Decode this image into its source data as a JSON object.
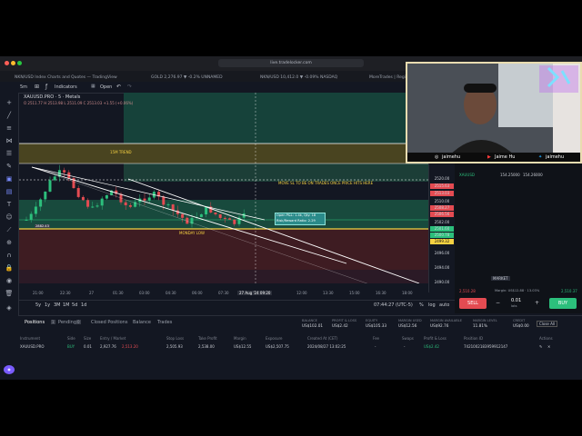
{
  "browser": {
    "address": "live.tradelocker.com",
    "tabs": [
      "NKN/USD Index Charts and Quotes — TradingView",
      "GOLD 2,276.97 ▼ -0.2% UNNAMED",
      "NKN/USD 10,412.0 ▼ -0.09% NASDAQ",
      "MoreTrades | Registrati..."
    ]
  },
  "toolbar": {
    "interval": "5m",
    "indicators_label": "Indicators",
    "open_label": "Open"
  },
  "chart": {
    "symbol": "XAUUSD.PRO · 5 · Metals",
    "ohlc": "O 2511.77  H 2513.98  L 2511.09  C 2513.03  +1.55 (+0.06%)",
    "annotations": {
      "trend": "15M TREND",
      "move_sl": "MOVE SL TO BE ON TRADES ONCE PRICE HITS HERE",
      "monday_low": "MONDAY LOW",
      "box_line1": "Open P&L: 1.4k, Qty: 18",
      "box_line2": "Risk/Reward Ratio: 2.29",
      "left_label": "2882.43"
    },
    "colors": {
      "green_zone": "#1a4a3a",
      "red_zone": "#4a1f24",
      "yellow_zone": "#5c5420",
      "accent_yellow": "#f5d142"
    }
  },
  "price_axis": {
    "labels": [
      {
        "text": "2520.00",
        "style": "plain"
      },
      {
        "text": "2515.63",
        "style": "red"
      },
      {
        "text": "2513.03",
        "style": "red"
      },
      {
        "text": "2510.00",
        "style": "plain"
      },
      {
        "text": "2508.27",
        "style": "red"
      },
      {
        "text": "2506.56",
        "style": "red"
      },
      {
        "text": "2502.00",
        "style": "plain"
      },
      {
        "text": "2501.60",
        "style": "green"
      },
      {
        "text": "2500.78",
        "style": "green"
      },
      {
        "text": "2499.32",
        "style": "yellow"
      },
      {
        "text": "2496.00",
        "style": "plain"
      },
      {
        "text": "2494.00",
        "style": "plain"
      },
      {
        "text": "2490.00",
        "style": "plain"
      }
    ]
  },
  "time_axis": {
    "labels": [
      "21:00",
      "22:30",
      "27",
      "01:30",
      "03:00",
      "04:30",
      "06:00",
      "07:30",
      "27 Aug '24  09:20",
      "12:00",
      "13:30",
      "15:00",
      "16:30",
      "18:00"
    ]
  },
  "bottom": {
    "ranges": [
      "5y",
      "1y",
      "3M",
      "1M",
      "5d",
      "1d"
    ],
    "time": "07:44:27 (UTC-5)",
    "opts": [
      "%",
      "log",
      "auto"
    ]
  },
  "positions_panel": {
    "tabs": [
      "Positions",
      "Pending",
      "Closed Positions",
      "Balance",
      "Trades"
    ],
    "positions_count": "1",
    "pending_count": "0",
    "summary": [
      {
        "label": "BALANCE",
        "value": "US$102.01"
      },
      {
        "label": "PROFIT & LOSS",
        "value": "US$2.42"
      },
      {
        "label": "EQUITY",
        "value": "US$105.33"
      },
      {
        "label": "MARGIN USED",
        "value": "US$12.56"
      },
      {
        "label": "MARGIN AVAILABLE",
        "value": "US$92.76"
      },
      {
        "label": "MARGIN LEVEL",
        "value": "11.81%"
      },
      {
        "label": "CREDIT",
        "value": "US$0.00"
      }
    ],
    "close_all": "Close All",
    "columns": [
      "Instrument",
      "Side",
      "Size",
      "Entry / Market",
      "Stop Loss",
      "Take Profit",
      "Margin",
      "Exposure",
      "Created At (CET)",
      "Fee",
      "Swaps",
      "Profit & Loss",
      "Position ID",
      "Actions"
    ],
    "row": {
      "instrument": "XAUUSD.PRO",
      "side": "BUY",
      "size": "0.01",
      "entry": "2,927.76",
      "market": "2,513.20",
      "stop_loss": "2,505.93",
      "take_profit": "2,538.00",
      "margin": "US$12.55",
      "exposure": "US$2,507.75",
      "created": "2024/08/27 13:02:25",
      "fee": "-",
      "swaps": "-",
      "pnl": "US$2.42",
      "position_id": "7421002183959912147"
    }
  },
  "webcam": {
    "instagram": "jaimehu",
    "youtube": "Jaime Hu",
    "twitter": "jaimehu"
  },
  "order_panel": {
    "instrument": "XAUUSD",
    "bid": "154.25000",
    "ask": "154.26000",
    "margin": "Margin: US$12.88 · 13.03%",
    "qty": "0.01",
    "qty_unit": "lots",
    "sell_price": "2,510.28",
    "buy_price": "2,510.37",
    "sell_label": "SELL",
    "buy_label": "BUY",
    "market_label": "MARKET"
  }
}
